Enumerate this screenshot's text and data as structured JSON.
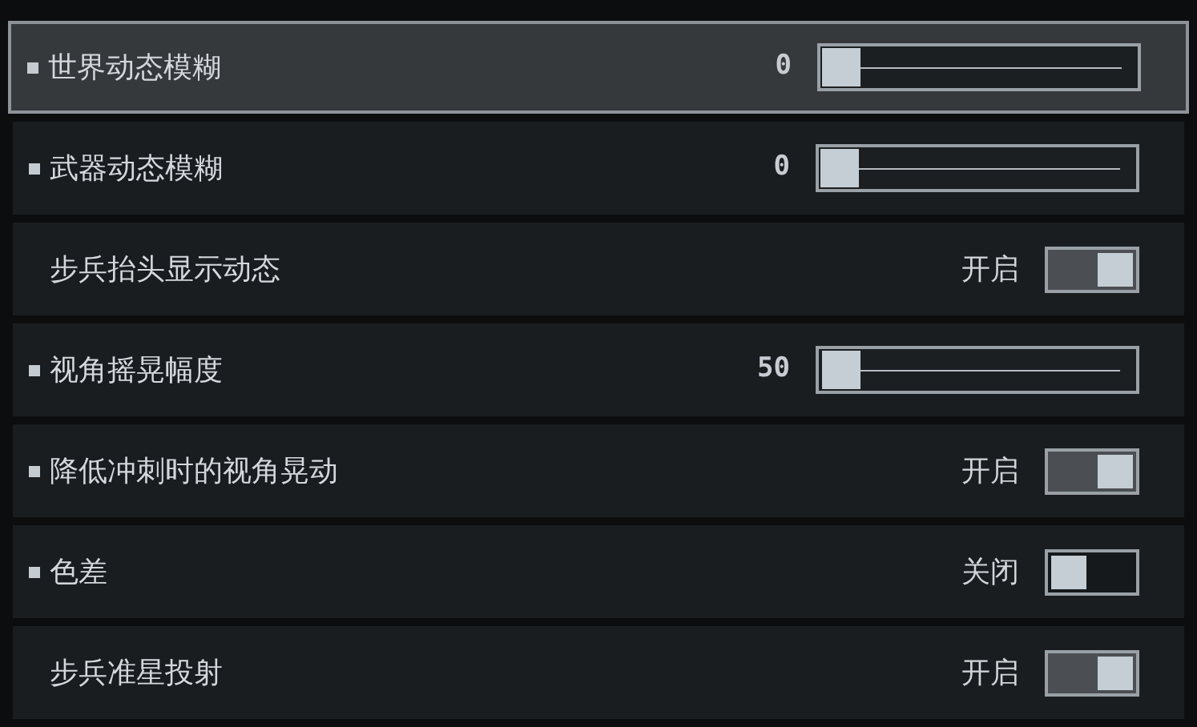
{
  "settings": [
    {
      "kind": "slider",
      "label": "世界动态模糊",
      "bullet": true,
      "selected": true,
      "value": "0",
      "level": 0
    },
    {
      "kind": "slider",
      "label": "武器动态模糊",
      "bullet": true,
      "selected": false,
      "value": "0",
      "level": 0
    },
    {
      "kind": "toggle",
      "label": "步兵抬头显示动态",
      "bullet": false,
      "selected": false,
      "value": "开启",
      "on": true
    },
    {
      "kind": "slider",
      "label": "视角摇晃幅度",
      "bullet": true,
      "selected": false,
      "value": "50",
      "level": 0.005
    },
    {
      "kind": "toggle",
      "label": "降低冲刺时的视角晃动",
      "bullet": true,
      "selected": false,
      "value": "开启",
      "on": true
    },
    {
      "kind": "toggle",
      "label": "色差",
      "bullet": true,
      "selected": false,
      "value": "关闭",
      "on": false
    },
    {
      "kind": "toggle",
      "label": "步兵准星投射",
      "bullet": false,
      "selected": false,
      "value": "开启",
      "on": true
    }
  ]
}
